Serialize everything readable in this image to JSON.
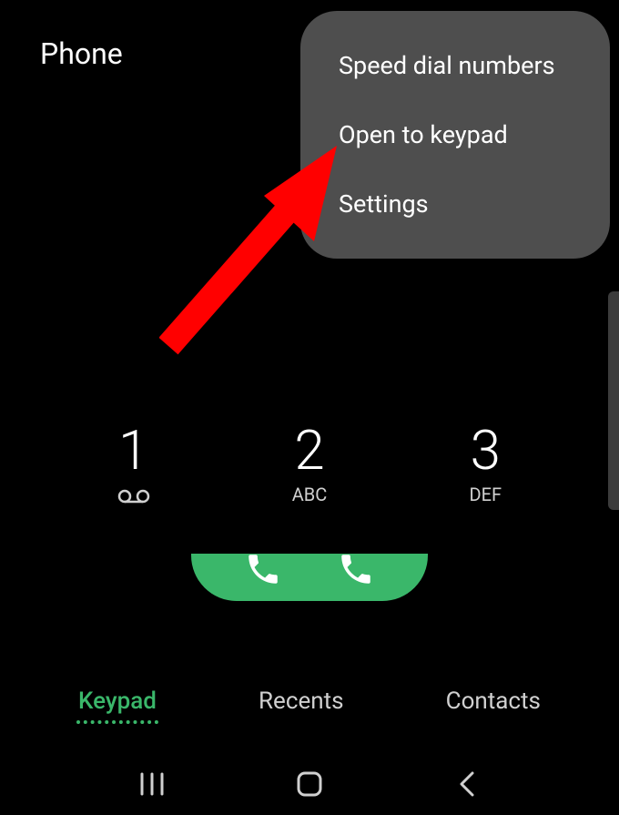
{
  "header": {
    "title": "Phone"
  },
  "dropdown": {
    "items": [
      {
        "label": "Speed dial numbers"
      },
      {
        "label": "Open to keypad"
      },
      {
        "label": "Settings"
      }
    ]
  },
  "keypad": {
    "keys": [
      {
        "number": "1",
        "letters": ""
      },
      {
        "number": "2",
        "letters": "ABC"
      },
      {
        "number": "3",
        "letters": "DEF"
      }
    ]
  },
  "tabs": {
    "items": [
      {
        "label": "Keypad",
        "active": true
      },
      {
        "label": "Recents",
        "active": false
      },
      {
        "label": "Contacts",
        "active": false
      }
    ]
  },
  "colors": {
    "accent": "#3ab76a",
    "background": "#000000",
    "menu_bg": "rgba(85,85,85,0.92)",
    "arrow": "#ff0000"
  }
}
